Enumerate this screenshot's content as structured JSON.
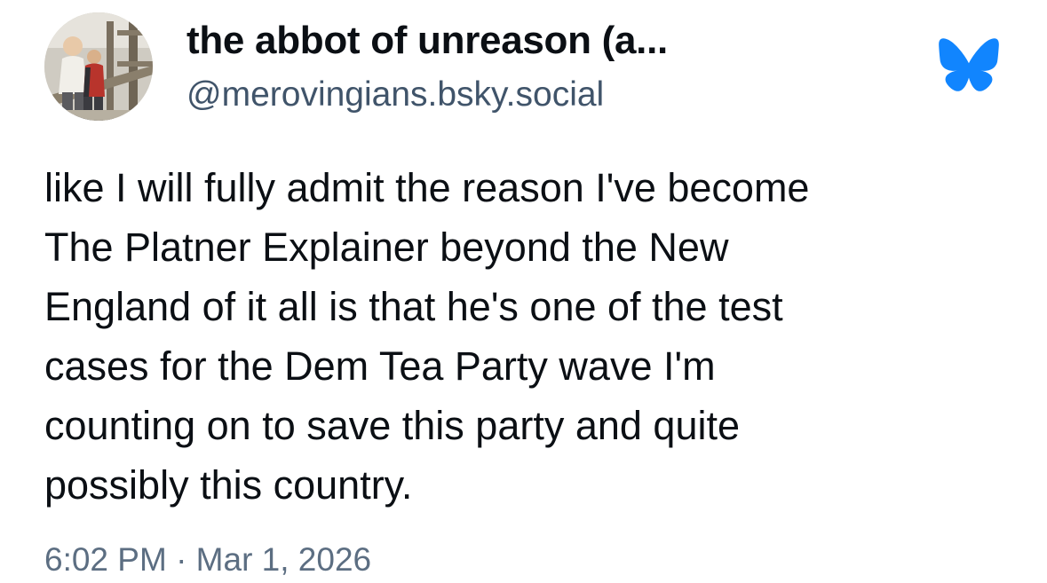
{
  "author": {
    "display_name": "the abbot of unreason (a...",
    "handle": "@merovingians.bsky.social",
    "avatar_icon": "profile-photo"
  },
  "brand": {
    "logo_icon": "bluesky-butterfly-icon",
    "color": "#1185fe"
  },
  "post": {
    "lines": [
      "like I will fully admit the reason I've become",
      "The Platner Explainer beyond the New",
      "England of it all is that he's one of the test",
      "cases for the Dem Tea Party wave I'm",
      "counting on to save this party and quite",
      "possibly this country."
    ],
    "timestamp": "6:02 PM · Mar 1, 2026"
  }
}
